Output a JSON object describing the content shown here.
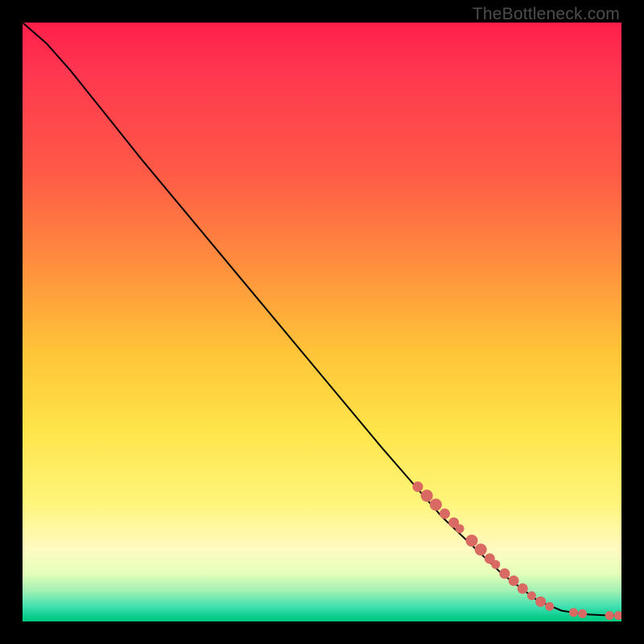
{
  "watermark": "TheBottleneck.com",
  "colors": {
    "curve": "#000000",
    "dot_fill": "#d96a63",
    "frame_bg": "#000000"
  },
  "chart_data": {
    "type": "line",
    "title": "",
    "xlabel": "",
    "ylabel": "",
    "xlim": [
      0,
      100
    ],
    "ylim": [
      0,
      100
    ],
    "grid": false,
    "legend": false,
    "curve_points": [
      {
        "x": 0,
        "y": 100
      },
      {
        "x": 4,
        "y": 96.5
      },
      {
        "x": 8,
        "y": 92
      },
      {
        "x": 12,
        "y": 87
      },
      {
        "x": 20,
        "y": 77
      },
      {
        "x": 30,
        "y": 65
      },
      {
        "x": 40,
        "y": 53
      },
      {
        "x": 50,
        "y": 41
      },
      {
        "x": 60,
        "y": 29
      },
      {
        "x": 70,
        "y": 17.5
      },
      {
        "x": 80,
        "y": 8
      },
      {
        "x": 86,
        "y": 3.5
      },
      {
        "x": 90,
        "y": 1.8
      },
      {
        "x": 94,
        "y": 1.2
      },
      {
        "x": 98,
        "y": 1.0
      },
      {
        "x": 100,
        "y": 1.0
      }
    ],
    "series": [
      {
        "name": "points",
        "type": "scatter",
        "marker": "circle",
        "color": "#d96a63",
        "data": [
          {
            "x": 66,
            "y": 22.5,
            "r": 6
          },
          {
            "x": 67.5,
            "y": 21,
            "r": 7
          },
          {
            "x": 69,
            "y": 19.5,
            "r": 7
          },
          {
            "x": 70.5,
            "y": 18,
            "r": 6
          },
          {
            "x": 72,
            "y": 16.5,
            "r": 6
          },
          {
            "x": 73,
            "y": 15.5,
            "r": 5
          },
          {
            "x": 75,
            "y": 13.5,
            "r": 7
          },
          {
            "x": 76.5,
            "y": 12,
            "r": 7
          },
          {
            "x": 78,
            "y": 10.5,
            "r": 6
          },
          {
            "x": 79,
            "y": 9.5,
            "r": 5
          },
          {
            "x": 80.5,
            "y": 8,
            "r": 6
          },
          {
            "x": 82,
            "y": 6.8,
            "r": 6
          },
          {
            "x": 83.5,
            "y": 5.5,
            "r": 6
          },
          {
            "x": 85,
            "y": 4.3,
            "r": 5
          },
          {
            "x": 86.5,
            "y": 3.3,
            "r": 6
          },
          {
            "x": 88,
            "y": 2.5,
            "r": 5
          },
          {
            "x": 92,
            "y": 1.5,
            "r": 5
          },
          {
            "x": 93.5,
            "y": 1.3,
            "r": 5
          },
          {
            "x": 98,
            "y": 1.0,
            "r": 5
          },
          {
            "x": 99.5,
            "y": 1.0,
            "r": 5
          }
        ]
      }
    ]
  }
}
